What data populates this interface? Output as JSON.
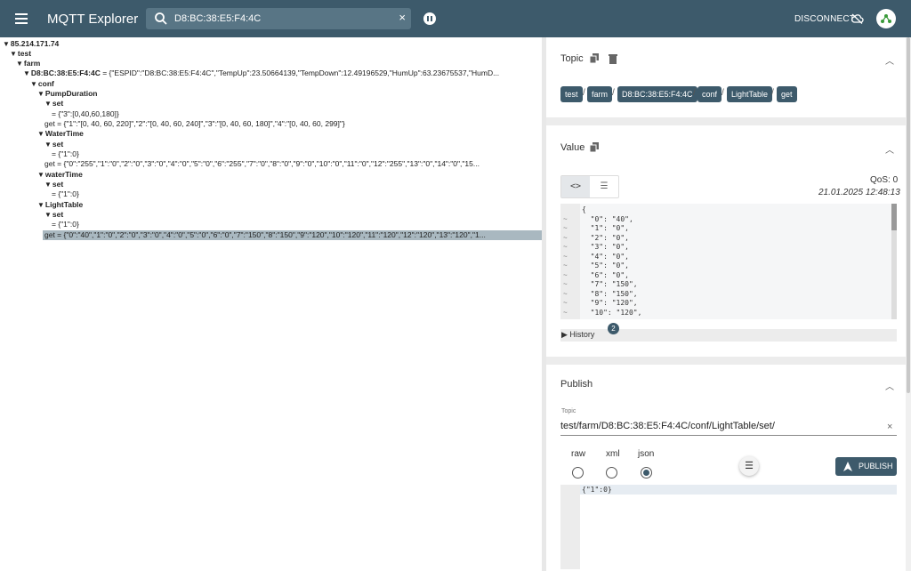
{
  "header": {
    "title": "MQTT Explorer",
    "search_value": "D8:BC:38:E5:F4:4C",
    "clear": "×",
    "disconnect": "DISCONNECT"
  },
  "tree": [
    {
      "text": "85.214.171.74",
      "value": ""
    },
    {
      "text": "test",
      "value": ""
    },
    {
      "text": "farm",
      "value": ""
    },
    {
      "text": "D8:BC:38:E5:F4:4C",
      "value": "= {\"ESPID\":\"D8:BC:38:E5:F4:4C\",\"TempUp\":23.50664139,\"TempDown\":12.49196529,\"HumUp\":63.23675537,\"HumD..."
    },
    {
      "text": "conf",
      "value": ""
    },
    {
      "text": "PumpDuration",
      "value": ""
    },
    {
      "text": "set",
      "value": ""
    },
    {
      "text": "",
      "value": "= {\"3\":[0,40,60,180]}"
    },
    {
      "text": "",
      "value": "get = {\"1\":\"[0, 40, 60, 220]\",\"2\":\"[0, 40, 60, 240]\",\"3\":\"[0, 40, 60, 180]\",\"4\":\"[0, 40, 60, 299]\"}"
    },
    {
      "text": "WaterTime",
      "value": ""
    },
    {
      "text": "set",
      "value": ""
    },
    {
      "text": "",
      "value": "= {\"1\":0}"
    },
    {
      "text": "",
      "value": "get = {\"0\":\"255\",\"1\":\"0\",\"2\":\"0\",\"3\":\"0\",\"4\":\"0\",\"5\":\"0\",\"6\":\"255\",\"7\":\"0\",\"8\":\"0\",\"9\":\"0\",\"10\":\"0\",\"11\":\"0\",\"12\":\"255\",\"13\":\"0\",\"14\":\"0\",\"15..."
    },
    {
      "text": "waterTime",
      "value": ""
    },
    {
      "text": "set",
      "value": ""
    },
    {
      "text": "",
      "value": "= {\"1\":0}"
    },
    {
      "text": "LightTable",
      "value": ""
    },
    {
      "text": "set",
      "value": ""
    },
    {
      "text": "",
      "value": "= {\"1\":0}"
    },
    {
      "text": "",
      "value": "get = {\"0\":\"40\",\"1\":\"0\",\"2\":\"0\",\"3\":\"0\",\"4\":\"0\",\"5\":\"0\",\"6\":\"0\",\"7\":\"150\",\"8\":\"150\",\"9\":\"120\",\"10\":\"120\",\"11\":\"120\",\"12\":\"120\",\"13\":\"120\",\"1..."
    }
  ],
  "topic_panel": {
    "title": "Topic",
    "chips": [
      "test",
      "farm",
      "D8:BC:38:E5:F4:4C",
      "conf",
      "LightTable",
      "get"
    ]
  },
  "value_panel": {
    "title": "Value",
    "qos": "QoS: 0",
    "timestamp": "21.01.2025 12:48:13",
    "code_lines": [
      "{",
      "  \"0\": \"40\",",
      "  \"1\": \"0\",",
      "  \"2\": \"0\",",
      "  \"3\": \"0\",",
      "  \"4\": \"0\",",
      "  \"5\": \"0\",",
      "  \"6\": \"0\",",
      "  \"7\": \"150\",",
      "  \"8\": \"150\",",
      "  \"9\": \"120\",",
      "  \"10\": \"120\","
    ],
    "history_label": "History",
    "history_count": "2"
  },
  "publish_panel": {
    "title": "Publish",
    "topic_label": "Topic",
    "topic_value": "test/farm/D8:BC:38:E5:F4:4C/conf/LightTable/set/",
    "formats": [
      "raw",
      "xml",
      "json"
    ],
    "selected_format": "json",
    "payload": "{\"1\":0}",
    "publish_label": "PUBLISH"
  },
  "colors": {
    "primary": "#3d5a6b",
    "selected_row": "#a9b8c0"
  }
}
